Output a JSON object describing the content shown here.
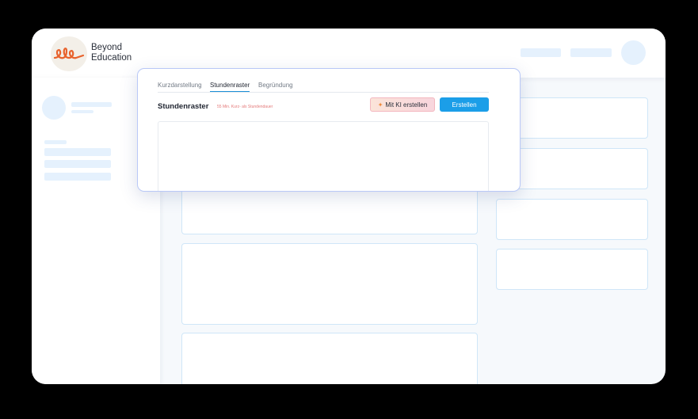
{
  "brand": {
    "line1": "Beyond",
    "line2": "Education",
    "logo_icon": "beyond-education-logo-icon",
    "accent_color": "#e8622c"
  },
  "modal": {
    "tabs": [
      {
        "label": "Kurzdarstellung",
        "active": false
      },
      {
        "label": "Stundenraster",
        "active": true
      },
      {
        "label": "Begründung",
        "active": false
      }
    ],
    "title": "Stundenraster",
    "subtitle": "55 Min. Kurz- als Stundendauer",
    "ai_button": {
      "label": "Mit KI erstellen",
      "icon": "sparkle-icon"
    },
    "create_button": {
      "label": "Erstellen"
    }
  },
  "colors": {
    "primary": "#1b9ee8",
    "skeleton": "#e5f1fd",
    "card_border": "#cfe6f8",
    "modal_border": "#b9c8f7"
  }
}
